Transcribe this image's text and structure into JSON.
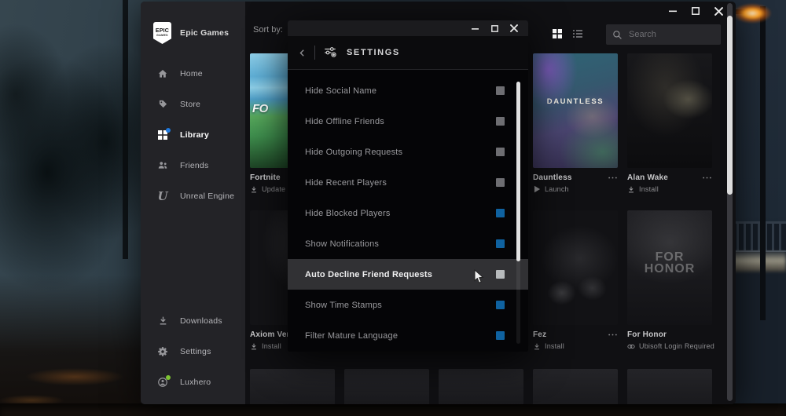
{
  "sidebar": {
    "logo": {
      "top": "EPIC",
      "bottom": "GAMES"
    },
    "brand": "Epic Games",
    "items": [
      {
        "label": "Home",
        "icon": "home",
        "active": false
      },
      {
        "label": "Store",
        "icon": "store",
        "active": false
      },
      {
        "label": "Library",
        "icon": "library",
        "active": true,
        "notification_dot": "#1f7ae0"
      },
      {
        "label": "Friends",
        "icon": "friends",
        "active": false
      },
      {
        "label": "Unreal Engine",
        "icon": "unreal",
        "active": false
      }
    ],
    "bottom_items": [
      {
        "label": "Downloads",
        "icon": "download",
        "active": false
      },
      {
        "label": "Settings",
        "icon": "gear",
        "active": false
      },
      {
        "label": "Luxhero",
        "icon": "avatar",
        "active": false,
        "status_dot": "#7ec432"
      }
    ]
  },
  "toolbar": {
    "sort_by_label": "Sort by:",
    "search_placeholder": "Search"
  },
  "library": {
    "games": [
      {
        "title": "Fortnite",
        "action": "Update",
        "action_icon": "download",
        "art": "fortnite",
        "art_text": "FO",
        "col": 0,
        "row": 0,
        "menu": true
      },
      {
        "title": "Dauntless",
        "action": "Launch",
        "action_icon": "play",
        "art": "dauntless",
        "art_text": "DAUNTLESS",
        "col": 3,
        "row": 0,
        "menu": true
      },
      {
        "title": "Alan Wake",
        "action": "Install",
        "action_icon": "download",
        "art": "alanwake",
        "art_text": "",
        "col": 4,
        "row": 0,
        "menu": true
      },
      {
        "title": "Axiom Verge",
        "action": "Install",
        "action_icon": "download",
        "art": "axiom",
        "art_text": "",
        "col": 0,
        "row": 1,
        "menu": true
      },
      {
        "title": "Fez",
        "action": "Install",
        "action_icon": "download",
        "art": "fez",
        "art_text": "",
        "col": 3,
        "row": 1,
        "menu": true
      },
      {
        "title": "For Honor",
        "action": "Ubisoft Login Required",
        "action_icon": "link",
        "art": "forhonor",
        "art_text": "FOR HONOR",
        "col": 4,
        "row": 1,
        "menu": false
      }
    ],
    "partial_row_cols": [
      0,
      1,
      2,
      3,
      4
    ]
  },
  "settings_modal": {
    "title": "SETTINGS",
    "items": [
      {
        "label": "Hide Social Name",
        "checked": false,
        "highlighted": false
      },
      {
        "label": "Hide Offline Friends",
        "checked": false,
        "highlighted": false
      },
      {
        "label": "Hide Outgoing Requests",
        "checked": false,
        "highlighted": false
      },
      {
        "label": "Hide Recent Players",
        "checked": false,
        "highlighted": false
      },
      {
        "label": "Hide Blocked Players",
        "checked": true,
        "highlighted": false
      },
      {
        "label": "Show Notifications",
        "checked": true,
        "highlighted": false
      },
      {
        "label": "Auto Decline Friend Requests",
        "checked": false,
        "highlighted": true
      },
      {
        "label": "Show Time Stamps",
        "checked": true,
        "highlighted": false
      },
      {
        "label": "Filter Mature Language",
        "checked": true,
        "highlighted": false
      }
    ],
    "colors": {
      "checked": "#0f62a0",
      "unchecked": "#6e6e72",
      "unchecked_highlight": "#b7babc"
    }
  }
}
